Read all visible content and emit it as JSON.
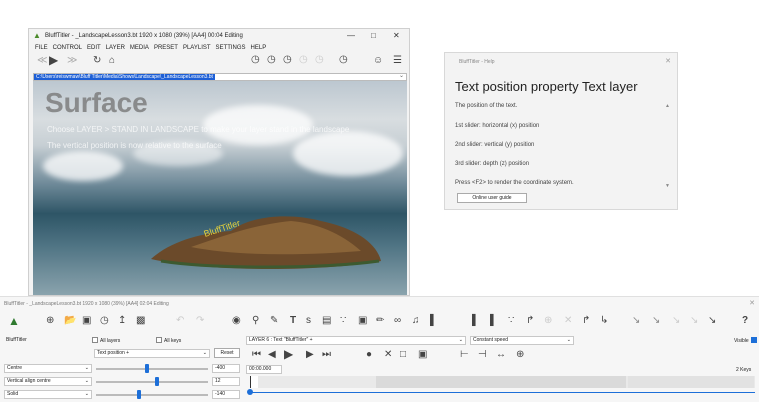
{
  "main_window": {
    "title": "BluffTitler - _LandscapeLesson3.bt 1920 x 1080 (39%) [AA4] 00:04 Editing",
    "minimize": "—",
    "maximize": "□",
    "close": "✕",
    "menu": [
      "FILE",
      "CONTROL",
      "EDIT",
      "LAYER",
      "MEDIA",
      "PRESET",
      "PLAYLIST",
      "SETTINGS",
      "HELP"
    ],
    "path": "C:\\Users\\reiswmaw\\Bluff Titler\\Media\\Shows\\Landscape\\_LandscapeLesson3.bt",
    "viewport": {
      "big_title": "Surface",
      "line1": "Choose LAYER > STAND IN LANDSCAPE to make your layer stand in the landscape",
      "line2": "The vertical position is now relative to the surface",
      "small_text": "BluffTitler"
    }
  },
  "help_window": {
    "title": "BluffTitler - Help",
    "close": "✕",
    "heading": "Text position property Text layer",
    "lines": [
      "The position of the text.",
      "1st slider: horizontal (x) position",
      "2nd slider: vertical (y) position",
      "3rd slider: depth (z) position",
      "Press <F2> to render the coordinate system."
    ],
    "button": "Online user guide"
  },
  "bottom_panel": {
    "title": "BluffTitler - _LandscapeLesson3.bt 1920 x 1080 (39%) [AA4] 02:04 Editing",
    "close": "✕",
    "layer_name": "BluffTitler",
    "all_layers": "All layers",
    "all_keys": "All keys",
    "property": "Text position +",
    "reset": "Reset",
    "layer_select": "LAYER 6 : Text \"BluffTitler\" +",
    "speed": "Constant speed",
    "visible": "Visible",
    "time": "00:00.000",
    "keys": "2 Keys",
    "dropdowns": [
      "Centre",
      "Vertical align centre",
      "Solid"
    ],
    "values": [
      "-400",
      "12",
      "-140"
    ],
    "slider_positions": [
      0.45,
      0.55,
      0.38
    ]
  }
}
